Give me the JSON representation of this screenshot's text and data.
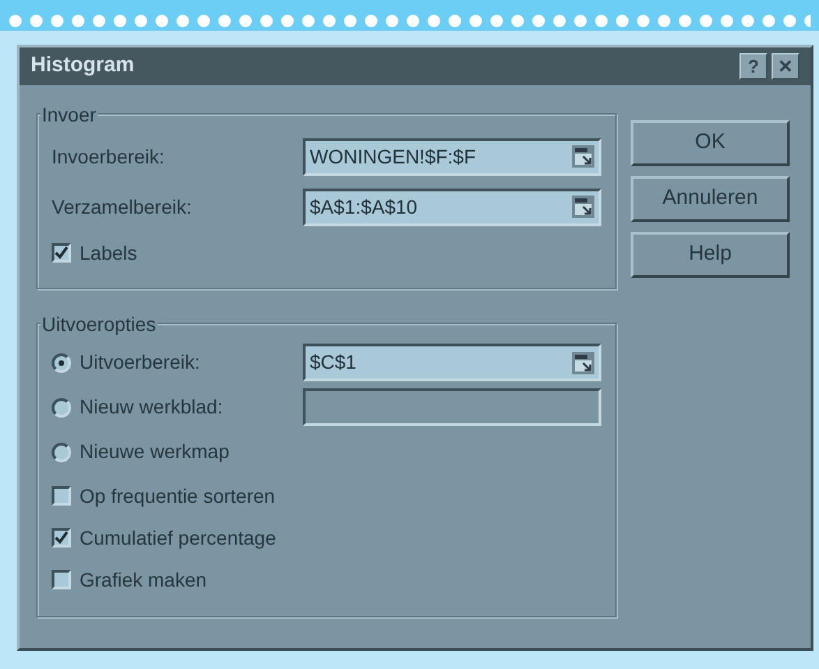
{
  "window": {
    "title": "Histogram",
    "title_buttons": [
      "?",
      "✕"
    ]
  },
  "input_group": {
    "title": "Invoer",
    "fields": [
      {
        "label": "Invoerbereik:",
        "value": "WONINGEN!$F:$F"
      },
      {
        "label": "Verzamelbereik:",
        "value": "$A$1:$A$10"
      }
    ],
    "checkboxes": [
      {
        "label": "Labels",
        "checked": true
      }
    ]
  },
  "output_group": {
    "title": "Uitvoeropties",
    "radios": [
      {
        "label": "Uitvoerbereik:",
        "selected": true,
        "field_value": "$C$1",
        "kind": "range"
      },
      {
        "label": "Nieuw werkblad:",
        "selected": false,
        "kind": "field"
      },
      {
        "label": "Nieuwe werkmap",
        "selected": false,
        "kind": "option"
      }
    ],
    "checkboxes": [
      {
        "label": "Op frequentie sorteren",
        "checked": false
      },
      {
        "label": "Cumulatief percentage",
        "checked": true
      },
      {
        "label": "Grafiek maken",
        "checked": false
      }
    ]
  },
  "buttons": [
    "OK",
    "Annuleren",
    "Help"
  ]
}
